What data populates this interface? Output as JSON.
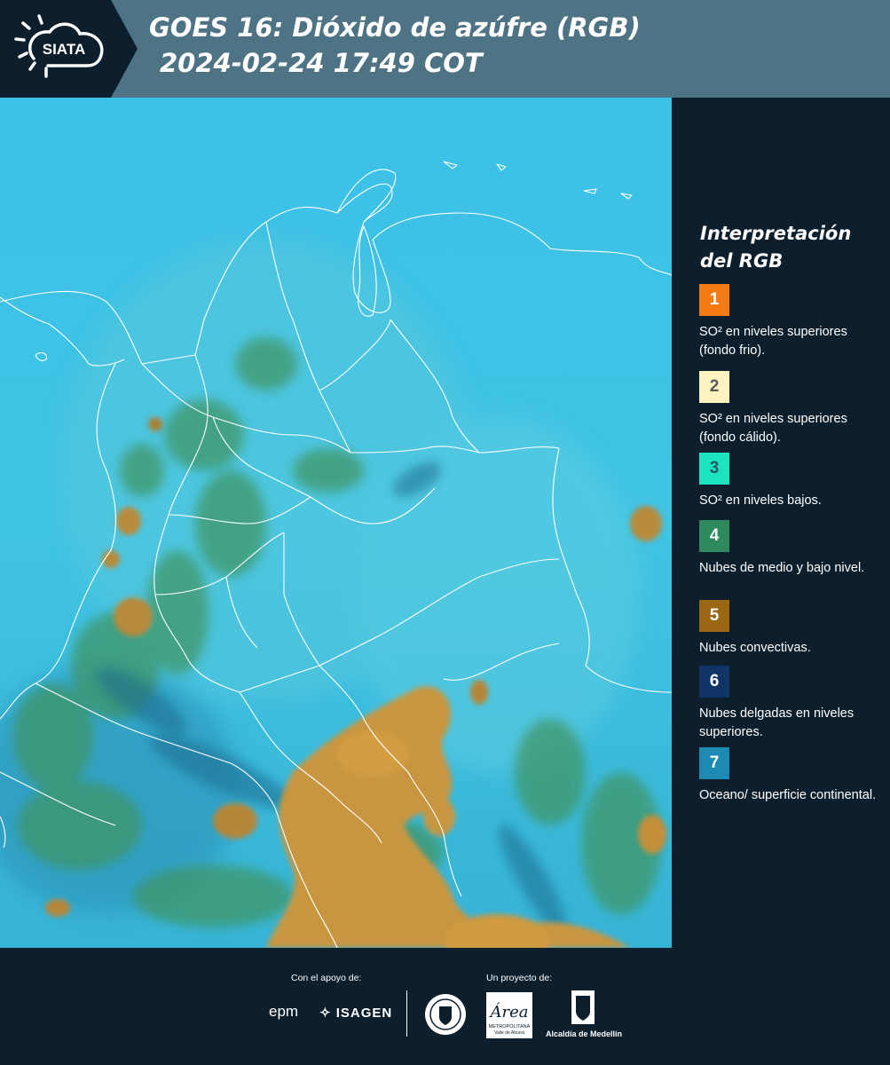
{
  "header": {
    "brand": "SIATA",
    "title_line1": "GOES 16: Dióxido de azúfre (RGB)",
    "title_line2": "2024-02-24 17:49 COT"
  },
  "legend": {
    "title": "Interpretación del RGB",
    "items": [
      {
        "num": "1",
        "color": "#f47a14",
        "text_color": "#ffffff",
        "label": "SO² en niveles superiores (fondo frio)."
      },
      {
        "num": "2",
        "color": "#fdf3c0",
        "text_color": "#5a5a5a",
        "label": "SO² en niveles superiores (fondo cálido)."
      },
      {
        "num": "3",
        "color": "#1de3c0",
        "text_color": "#1b5c60",
        "label": "SO² en niveles bajos."
      },
      {
        "num": "4",
        "color": "#2e8a5c",
        "text_color": "#ffffff",
        "label": "Nubes de medio y bajo nivel."
      },
      {
        "num": "5",
        "color": "#9b6714",
        "text_color": "#ffffff",
        "label": "Nubes convectivas."
      },
      {
        "num": "6",
        "color": "#0f3566",
        "text_color": "#ffffff",
        "label": "Nubes delgadas en niveles superiores."
      },
      {
        "num": "7",
        "color": "#1c8ab3",
        "text_color": "#ffffff",
        "label": "Oceano/ superficie continental."
      }
    ]
  },
  "footer": {
    "support_label": "Con el apoyo de:",
    "project_label": "Un proyecto de:",
    "epm": "epm",
    "isagen": "ISAGEN",
    "metro_text": "METROPOLITANA",
    "metro_sub": "Valle de Aburrá",
    "alcaldia": "Alcaldía de Medellín"
  },
  "colors": {
    "background": "#0d1f2d",
    "header_band": "#4e7384",
    "sea": "#3fc2e3",
    "cloud_warm": "#c9963c",
    "cloud_green": "#3e8f5a"
  }
}
